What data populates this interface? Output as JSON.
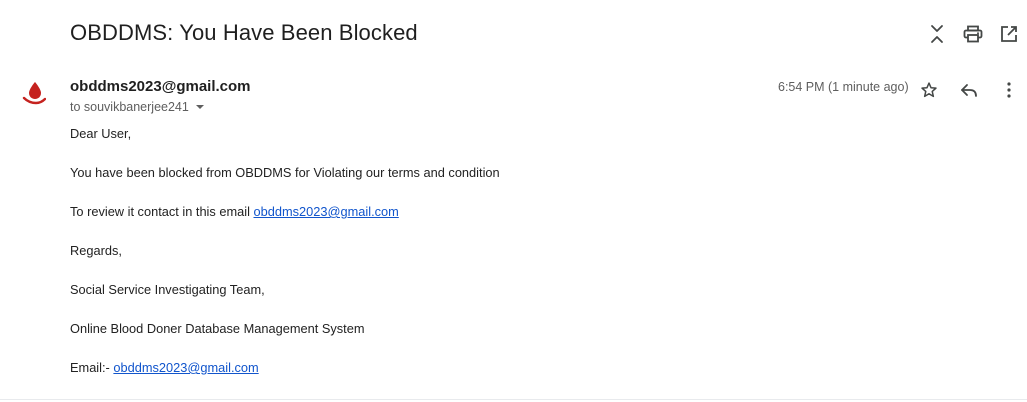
{
  "subject": "OBDDMS: You Have Been Blocked",
  "sender": {
    "email": "obddms2023@gmail.com",
    "to_label": "to souvikbanerjee241"
  },
  "timestamp": "6:54 PM (1 minute ago)",
  "body": {
    "greeting": "Dear User,",
    "line1": "You have been blocked from OBDDMS for Violating our terms and condition",
    "line2_prefix": "To review it contact in this email ",
    "line2_link": "obddms2023@gmail.com",
    "regards": "Regards,",
    "team": "Social Service Investigating Team,",
    "org": "Online Blood Doner Database Management System",
    "email_prefix": "Email:- ",
    "email_link": "obddms2023@gmail.com"
  },
  "icons": {
    "top": [
      "expand-collapse-icon",
      "print-icon",
      "open-in-new-window-icon"
    ],
    "message": [
      "star-icon",
      "reply-icon",
      "more-options-icon"
    ],
    "avatar": "blood-drop-hand-icon"
  },
  "colors": {
    "link": "#1155cc",
    "avatar_red": "#c5221f",
    "muted": "#5e5e5e"
  }
}
